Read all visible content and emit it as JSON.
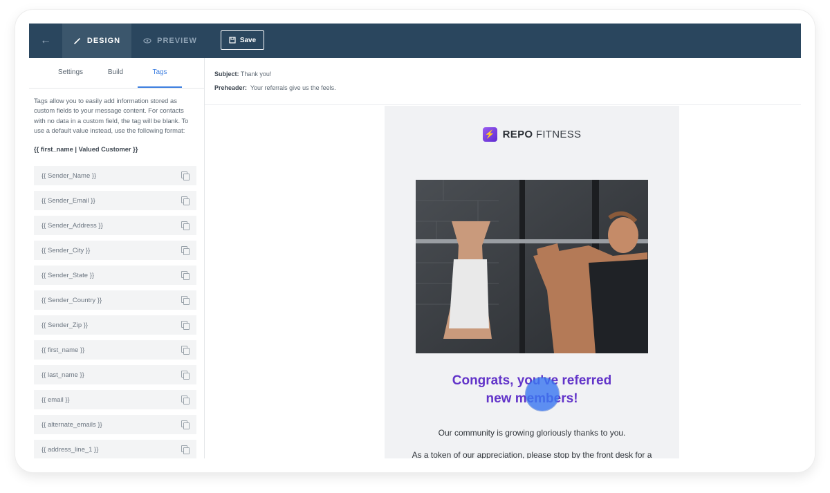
{
  "topbar": {
    "back_icon": "arrow-left-icon",
    "tabs": [
      {
        "label": "DESIGN",
        "icon": "pencil-icon",
        "active": true
      },
      {
        "label": "PREVIEW",
        "icon": "eye-icon",
        "active": false
      }
    ],
    "save_label": "Save",
    "save_icon": "save-icon"
  },
  "left_panel": {
    "tabs": [
      {
        "label": "Settings",
        "active": false
      },
      {
        "label": "Build",
        "active": false
      },
      {
        "label": "Tags",
        "active": true
      }
    ],
    "description": "Tags allow you to easily add information stored as custom fields to your message content. For contacts with no data in a custom field, the tag will be blank. To use a default value instead, use the following format:",
    "format_example": "{{ first_name | Valued Customer }}",
    "tags": [
      "{{ Sender_Name }}",
      "{{ Sender_Email }}",
      "{{ Sender_Address }}",
      "{{ Sender_City }}",
      "{{ Sender_State }}",
      "{{ Sender_Country }}",
      "{{ Sender_Zip }}",
      "{{ first_name }}",
      "{{ last_name }}",
      "{{ email }}",
      "{{ alternate_emails }}",
      "{{ address_line_1 }}"
    ]
  },
  "email": {
    "subject_label": "Subject:",
    "subject": "Thank you!",
    "preheader_label": "Preheader:",
    "preheader": "Your referrals give us the feels.",
    "brand_bold": "REPO",
    "brand_rest": " FITNESS",
    "headline_line1": "Congrats, you've referred",
    "headline_line2": "new members!",
    "body_line1": "Our community is growing gloriously thanks to you.",
    "body_line2": "As a token of our appreciation, please stop by the front desk for a",
    "colors": {
      "headline": "#6234c9",
      "topbar": "#2a465e",
      "accent": "#3c7ee0"
    }
  }
}
